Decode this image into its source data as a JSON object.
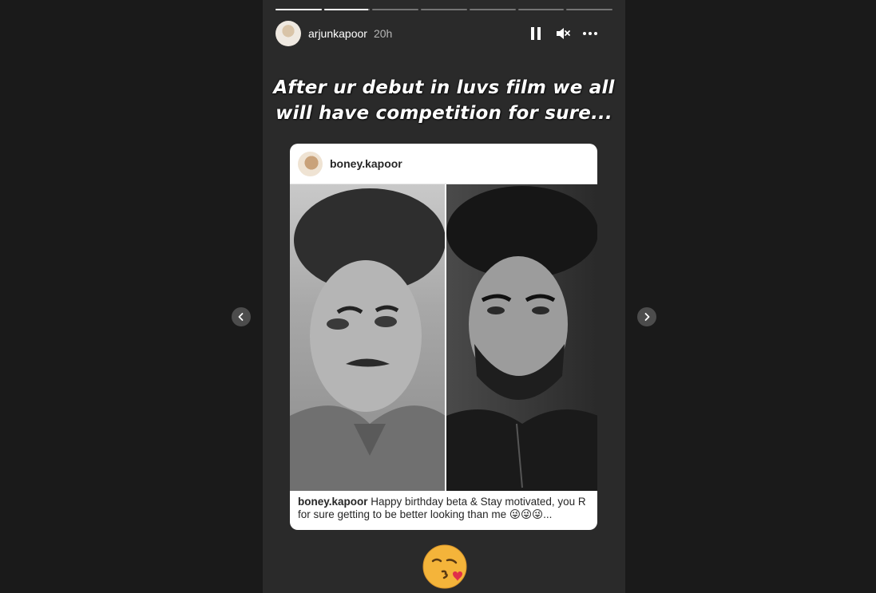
{
  "story": {
    "username": "arjunkapoor",
    "time_ago": "20h",
    "segments": 7,
    "progress": [
      1,
      0.95,
      0,
      0,
      0,
      0,
      0
    ],
    "caption_line1": "After ur debut in luvs film we all",
    "caption_line2": "will have competition for sure...",
    "icons": [
      "pause-icon",
      "mute-icon",
      "more-options-icon",
      "kiss-emoji-sticker"
    ]
  },
  "shared_post": {
    "username": "boney.kapoor",
    "caption_user": "boney.kapoor",
    "caption_text": " Happy birthday beta & Stay motivated, you R for sure getting to be better looking than me 😜😜😜..."
  },
  "nav": {
    "prev": "chevron-left-icon",
    "next": "chevron-right-icon"
  }
}
